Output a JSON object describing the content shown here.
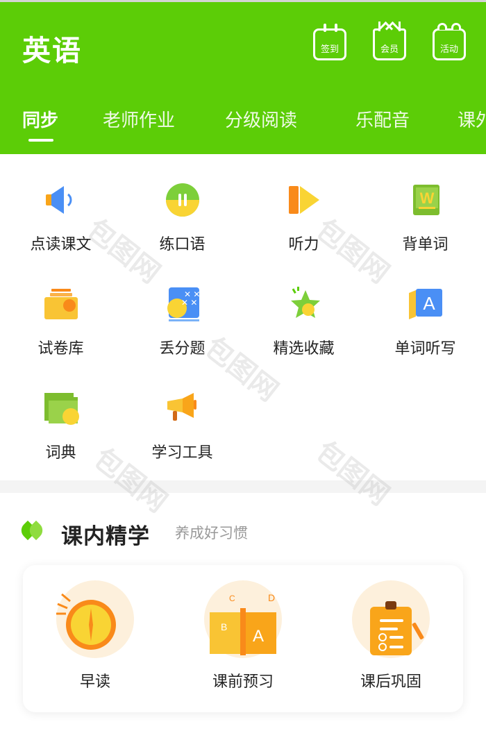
{
  "header": {
    "title": "英语",
    "buttons": [
      {
        "label": "签到",
        "icon": "calendar-icon"
      },
      {
        "label": "会员",
        "icon": "crown-icon"
      },
      {
        "label": "活动",
        "icon": "gift-icon"
      }
    ]
  },
  "tabs": [
    "同步",
    "老师作业",
    "分级阅读",
    "乐配音",
    "课外"
  ],
  "active_tab": "同步",
  "tools": [
    {
      "label": "点读课文",
      "icon": "speaker-icon"
    },
    {
      "label": "练口语",
      "icon": "pause-circle-icon"
    },
    {
      "label": "听力",
      "icon": "play-icon"
    },
    {
      "label": "背单词",
      "icon": "word-book-icon"
    },
    {
      "label": "试卷库",
      "icon": "folder-icon"
    },
    {
      "label": "丢分题",
      "icon": "mistake-card-icon"
    },
    {
      "label": "精选收藏",
      "icon": "star-icon"
    },
    {
      "label": "单词听写",
      "icon": "letter-a-icon"
    },
    {
      "label": "词典",
      "icon": "dictionary-icon"
    },
    {
      "label": "学习工具",
      "icon": "megaphone-icon"
    }
  ],
  "section": {
    "title": "课内精学",
    "subtitle": "养成好习惯",
    "items": [
      {
        "label": "早读",
        "icon": "clock-icon"
      },
      {
        "label": "课前预习",
        "icon": "open-book-icon"
      },
      {
        "label": "课后巩固",
        "icon": "clipboard-icon"
      }
    ]
  },
  "watermark": "包图网",
  "colors": {
    "brand": "#5ccd07",
    "accent_orange": "#f9a51a",
    "accent_yellow": "#f9d434",
    "accent_blue": "#4a8ff5"
  }
}
